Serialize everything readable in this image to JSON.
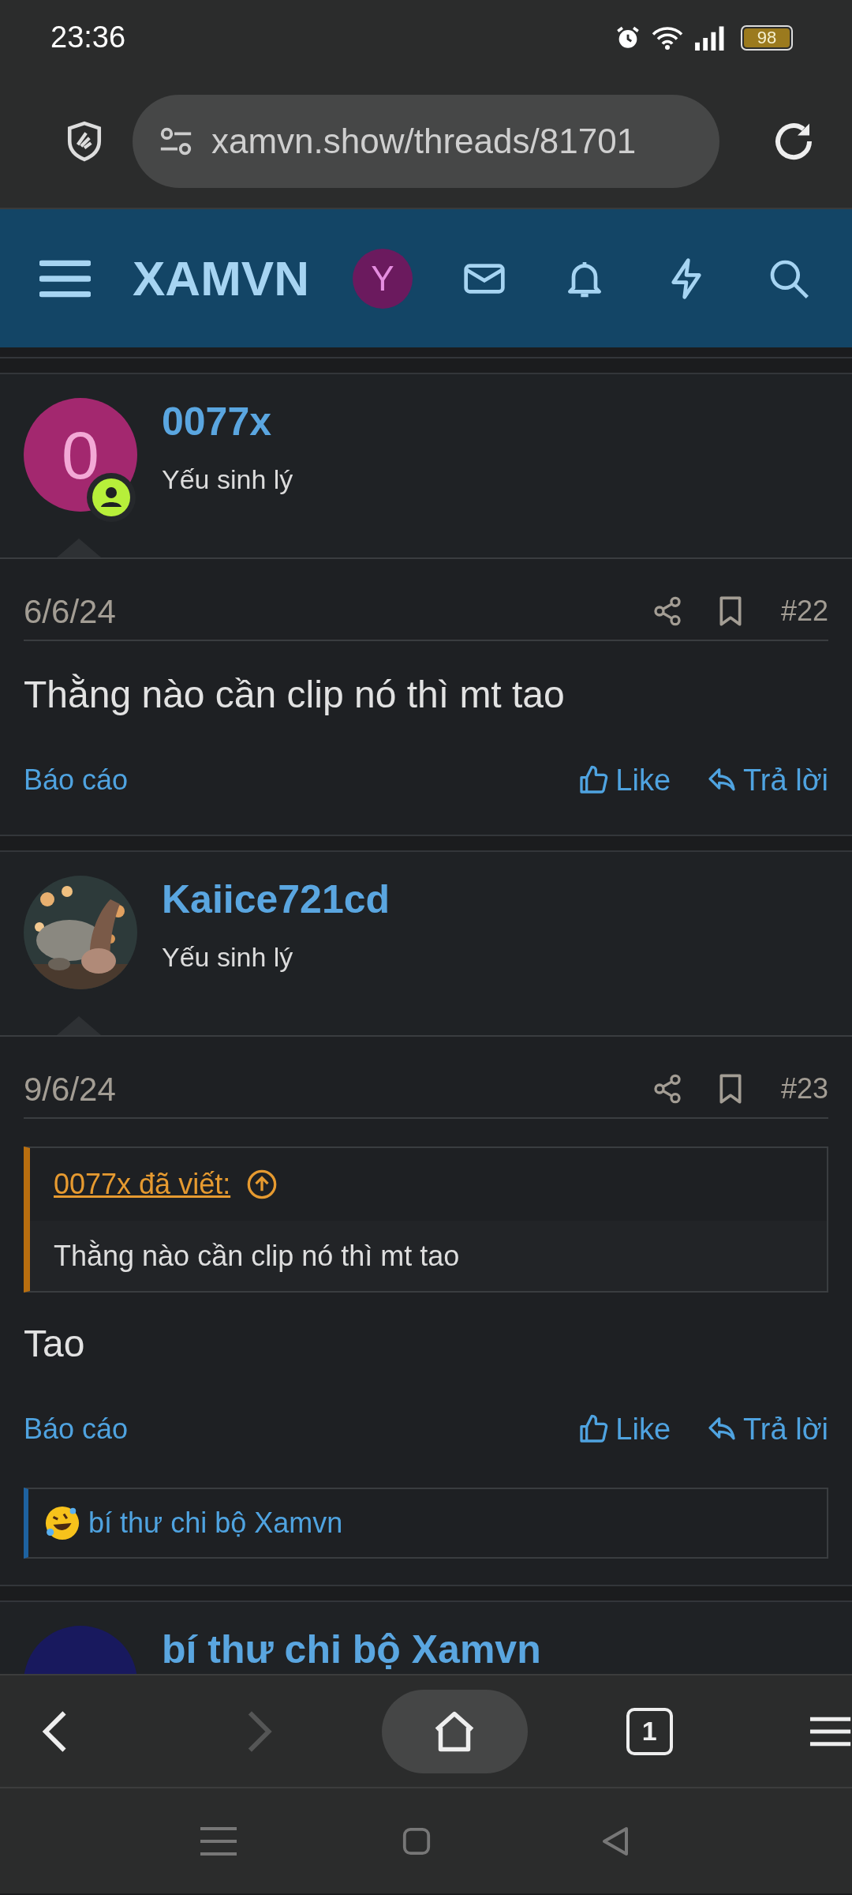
{
  "status_bar": {
    "time": "23:36",
    "battery": "98"
  },
  "browser": {
    "url": "xamvn.show/threads/81701"
  },
  "site_header": {
    "logo": "XAMVN",
    "account_letter": "Y"
  },
  "posts": [
    {
      "user": {
        "name": "0077x",
        "rank": "Yếu sinh lý",
        "avatar": {
          "kind": "letter",
          "letter": "0",
          "color": "#a3286f"
        },
        "online": true
      },
      "date": "6/6/24",
      "number": "#22",
      "body": "Thằng nào cần clip nó thì mt tao",
      "actions": {
        "report": "Báo cáo",
        "like": "Like",
        "reply": "Trả lời"
      }
    },
    {
      "user": {
        "name": "Kaiice721cd",
        "rank": "Yếu sinh lý",
        "online": false
      },
      "date": "9/6/24",
      "number": "#23",
      "quote": {
        "author": "0077x đã viết:",
        "text": "Thằng nào cần clip nó thì mt tao"
      },
      "body": "Tao",
      "actions": {
        "report": "Báo cáo",
        "like": "Like",
        "reply": "Trả lời"
      },
      "reactions": {
        "users": "bí thư chi bộ Xamvn"
      }
    },
    {
      "user": {
        "name": "bí thư chi bộ Xamvn",
        "avatar": {
          "kind": "letter",
          "color": "#18195e"
        }
      }
    }
  ],
  "bottom_nav": {
    "forward_disabled": true,
    "tab_count": "1"
  }
}
